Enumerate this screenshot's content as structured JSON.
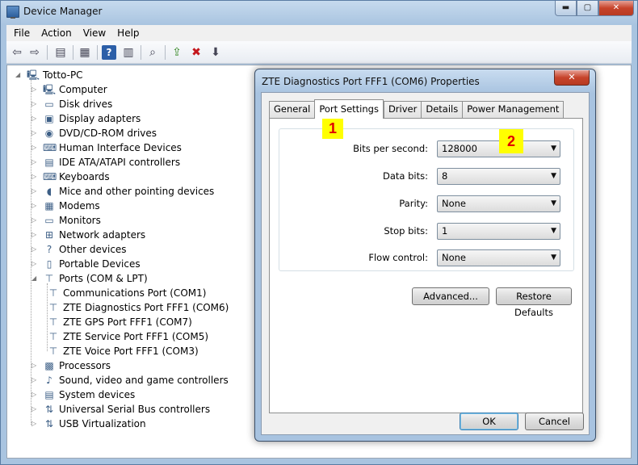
{
  "window": {
    "title": "Device Manager",
    "caption": {
      "minimize": "▬",
      "maximize": "▢",
      "close": "✕"
    }
  },
  "menu": [
    "File",
    "Action",
    "View",
    "Help"
  ],
  "toolbar_icons": [
    "back-icon",
    "forward-icon",
    "show-hide-tree-icon",
    "properties-icon",
    "help-icon",
    "view-icon",
    "scan-hardware-icon",
    "update-driver-icon",
    "uninstall-icon",
    "disable-icon"
  ],
  "tree": {
    "root": "Totto-PC",
    "categories": [
      {
        "label": "Computer",
        "icon": "computer-icon"
      },
      {
        "label": "Disk drives",
        "icon": "disk-icon"
      },
      {
        "label": "Display adapters",
        "icon": "display-icon"
      },
      {
        "label": "DVD/CD-ROM drives",
        "icon": "dvd-icon"
      },
      {
        "label": "Human Interface Devices",
        "icon": "hid-icon"
      },
      {
        "label": "IDE ATA/ATAPI controllers",
        "icon": "ide-icon"
      },
      {
        "label": "Keyboards",
        "icon": "keyboard-icon"
      },
      {
        "label": "Mice and other pointing devices",
        "icon": "mouse-icon"
      },
      {
        "label": "Modems",
        "icon": "modem-icon"
      },
      {
        "label": "Monitors",
        "icon": "monitor-icon"
      },
      {
        "label": "Network adapters",
        "icon": "network-icon"
      },
      {
        "label": "Other devices",
        "icon": "unknown-device-icon"
      },
      {
        "label": "Portable Devices",
        "icon": "portable-icon"
      },
      {
        "label": "Ports (COM & LPT)",
        "icon": "port-icon"
      }
    ],
    "ports": [
      "Communications Port (COM1)",
      "ZTE Diagnostics Port FFF1 (COM6)",
      "ZTE GPS Port FFF1 (COM7)",
      "ZTE Service Port FFF1 (COM5)",
      "ZTE Voice Port FFF1 (COM3)"
    ],
    "categories_after": [
      {
        "label": "Processors",
        "icon": "cpu-icon"
      },
      {
        "label": "Sound, video and game controllers",
        "icon": "sound-icon"
      },
      {
        "label": "System devices",
        "icon": "system-icon"
      },
      {
        "label": "Universal Serial Bus controllers",
        "icon": "usb-icon"
      },
      {
        "label": "USB Virtualization",
        "icon": "usb-virtual-icon"
      }
    ]
  },
  "dialog": {
    "title": "ZTE Diagnostics Port FFF1 (COM6) Properties",
    "tabs": [
      "General",
      "Port Settings",
      "Driver",
      "Details",
      "Power Management"
    ],
    "active_tab": "Port Settings",
    "fields": [
      {
        "label": "Bits per second:",
        "value": "128000"
      },
      {
        "label": "Data bits:",
        "value": "8"
      },
      {
        "label": "Parity:",
        "value": "None"
      },
      {
        "label": "Stop bits:",
        "value": "1"
      },
      {
        "label": "Flow control:",
        "value": "None"
      }
    ],
    "advanced_button": "Advanced...",
    "restore_button": "Restore Defaults",
    "ok_button": "OK",
    "cancel_button": "Cancel"
  },
  "markers": [
    "1",
    "2"
  ],
  "colors": {
    "marker_bg": "#ffff00",
    "marker_text": "#e00000",
    "close_button": "#c7442b"
  }
}
